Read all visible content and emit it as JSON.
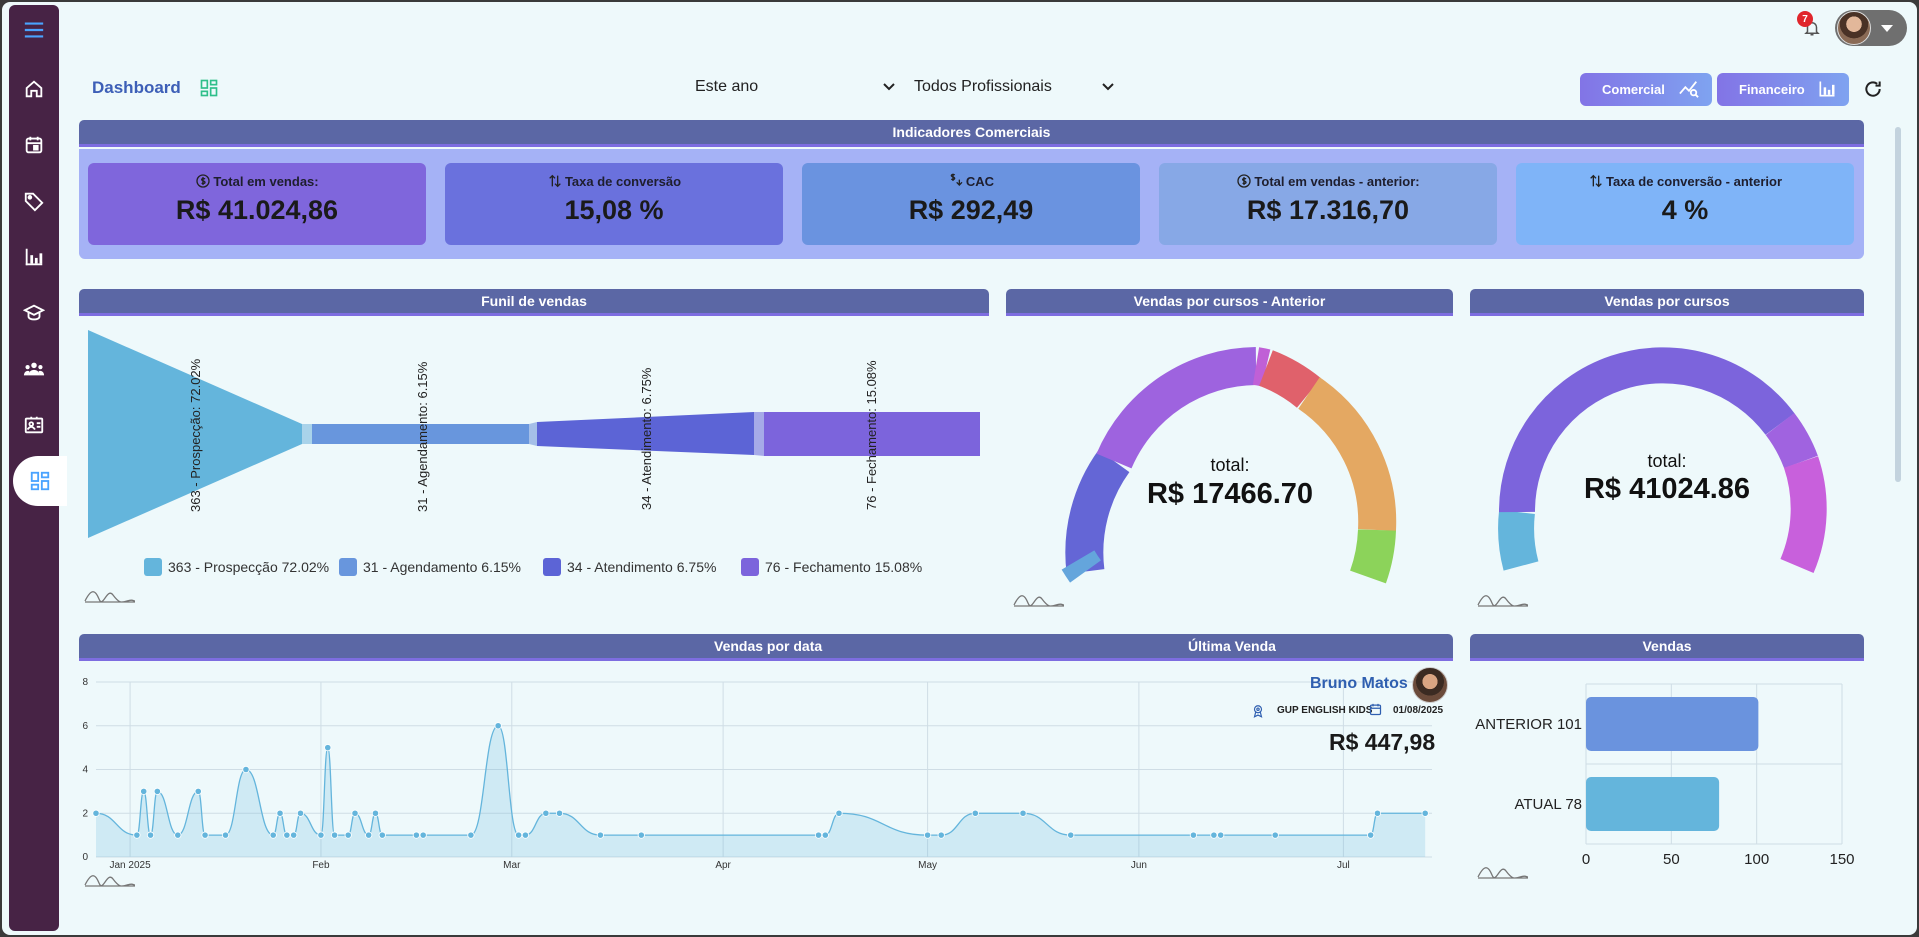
{
  "header": {
    "title": "Dashboard",
    "notifications_count": "7",
    "period_select": "Este ano",
    "professional_select": "Todos Profissionais",
    "btn_comercial": "Comercial",
    "btn_financeiro": "Financeiro"
  },
  "sidebar": {
    "items": [
      {
        "icon": "menu-icon"
      },
      {
        "icon": "home-icon"
      },
      {
        "icon": "calendar-icon"
      },
      {
        "icon": "tag-icon"
      },
      {
        "icon": "bar-chart-icon"
      },
      {
        "icon": "graduation-cap-icon"
      },
      {
        "icon": "users-icon"
      },
      {
        "icon": "id-card-icon"
      },
      {
        "icon": "dashboard-icon",
        "active": true
      }
    ]
  },
  "indicators": {
    "title": "Indicadores Comerciais",
    "kpis": [
      {
        "label": "Total em vendas:",
        "value": "R$ 41.024,86",
        "icon": "dollar-circle-icon",
        "color": "#7f66dc"
      },
      {
        "label": "Taxa de conversão",
        "value": "15,08 %",
        "icon": "swap-arrows-icon",
        "color": "#6a71dd"
      },
      {
        "label": "CAC",
        "value": "R$ 292,49",
        "icon": "dollar-trend-icon",
        "color": "#6a93e0"
      },
      {
        "label": "Total em vendas - anterior:",
        "value": "R$ 17.316,70",
        "icon": "dollar-circle-icon",
        "color": "#87a8e6"
      },
      {
        "label": "Taxa de conversão - anterior",
        "value": "4 %",
        "icon": "swap-arrows-icon",
        "color": "#7fb4f8"
      }
    ]
  },
  "funnel": {
    "title": "Funil de vendas",
    "stages": [
      {
        "label": "363 - Prospecção: 72.02%",
        "legend": "363 - Prospecção  72.02%",
        "color": "#64b5dc"
      },
      {
        "label": "31 - Agendamento: 6.15%",
        "legend": "31 - Agendamento  6.15%",
        "color": "#6896dd"
      },
      {
        "label": "34 - Atendimento: 6.75%",
        "legend": "34 - Atendimento  6.75%",
        "color": "#5c64d6"
      },
      {
        "label": "76 - Fechamento: 15.08%",
        "legend": "76 - Fechamento  15.08%",
        "color": "#7c64dc"
      }
    ]
  },
  "gauge_previous": {
    "title": "Vendas por cursos - Anterior",
    "total_label": "total:",
    "total_value": "R$ 17466.70"
  },
  "gauge_current": {
    "title": "Vendas por cursos",
    "total_label": "total:",
    "total_value": "R$ 41024.86"
  },
  "sales_by_date": {
    "title": "Vendas por data",
    "last_sale_title": "Última Venda",
    "last_sale": {
      "name": "Bruno Matos",
      "course": "GUP ENGLISH KIDS",
      "date": "01/08/2025",
      "value": "R$ 447,98"
    }
  },
  "sales": {
    "title": "Vendas"
  },
  "chart_data": [
    {
      "type": "area",
      "x_ticks": [
        "Jan 2025",
        "Feb",
        "Mar",
        "Apr",
        "May",
        "Jun",
        "Jul"
      ],
      "y_ticks": [
        "0",
        "2",
        "4",
        "6",
        "8"
      ],
      "ylim": [
        0,
        8
      ],
      "points": [
        {
          "x": "2025-01-01",
          "y": 2
        },
        {
          "x": "2025-01-07",
          "y": 1
        },
        {
          "x": "2025-01-08",
          "y": 3
        },
        {
          "x": "2025-01-09",
          "y": 1
        },
        {
          "x": "2025-01-10",
          "y": 3
        },
        {
          "x": "2025-01-13",
          "y": 1
        },
        {
          "x": "2025-01-16",
          "y": 3
        },
        {
          "x": "2025-01-17",
          "y": 1
        },
        {
          "x": "2025-01-20",
          "y": 1
        },
        {
          "x": "2025-01-23",
          "y": 4
        },
        {
          "x": "2025-01-27",
          "y": 1
        },
        {
          "x": "2025-01-28",
          "y": 2
        },
        {
          "x": "2025-01-29",
          "y": 1
        },
        {
          "x": "2025-01-30",
          "y": 1
        },
        {
          "x": "2025-01-31",
          "y": 2
        },
        {
          "x": "2025-02-03",
          "y": 1
        },
        {
          "x": "2025-02-04",
          "y": 5
        },
        {
          "x": "2025-02-05",
          "y": 1
        },
        {
          "x": "2025-02-07",
          "y": 1
        },
        {
          "x": "2025-02-08",
          "y": 2
        },
        {
          "x": "2025-02-10",
          "y": 1
        },
        {
          "x": "2025-02-11",
          "y": 2
        },
        {
          "x": "2025-02-12",
          "y": 1
        },
        {
          "x": "2025-02-17",
          "y": 1
        },
        {
          "x": "2025-02-18",
          "y": 1
        },
        {
          "x": "2025-02-25",
          "y": 1
        },
        {
          "x": "2025-03-01",
          "y": 6
        },
        {
          "x": "2025-03-04",
          "y": 1
        },
        {
          "x": "2025-03-05",
          "y": 1
        },
        {
          "x": "2025-03-08",
          "y": 2
        },
        {
          "x": "2025-03-10",
          "y": 2
        },
        {
          "x": "2025-03-16",
          "y": 1
        },
        {
          "x": "2025-03-22",
          "y": 1
        },
        {
          "x": "2025-04-17",
          "y": 1
        },
        {
          "x": "2025-04-18",
          "y": 1
        },
        {
          "x": "2025-04-20",
          "y": 2
        },
        {
          "x": "2025-05-03",
          "y": 1
        },
        {
          "x": "2025-05-05",
          "y": 1
        },
        {
          "x": "2025-05-10",
          "y": 2
        },
        {
          "x": "2025-05-17",
          "y": 2
        },
        {
          "x": "2025-05-24",
          "y": 1
        },
        {
          "x": "2025-06-11",
          "y": 1
        },
        {
          "x": "2025-06-14",
          "y": 1
        },
        {
          "x": "2025-06-15",
          "y": 1
        },
        {
          "x": "2025-06-23",
          "y": 1
        },
        {
          "x": "2025-07-07",
          "y": 1
        },
        {
          "x": "2025-07-08",
          "y": 2
        },
        {
          "x": "2025-07-15",
          "y": 2
        }
      ]
    },
    {
      "type": "bar",
      "orientation": "horizontal",
      "categories": [
        "ANTERIOR 101",
        "ATUAL 78"
      ],
      "values": [
        101,
        78
      ],
      "colors": [
        "#6a93de",
        "#64b5dc"
      ],
      "x_ticks": [
        "0",
        "50",
        "100",
        "150"
      ],
      "xlim": [
        0,
        150
      ]
    }
  ]
}
